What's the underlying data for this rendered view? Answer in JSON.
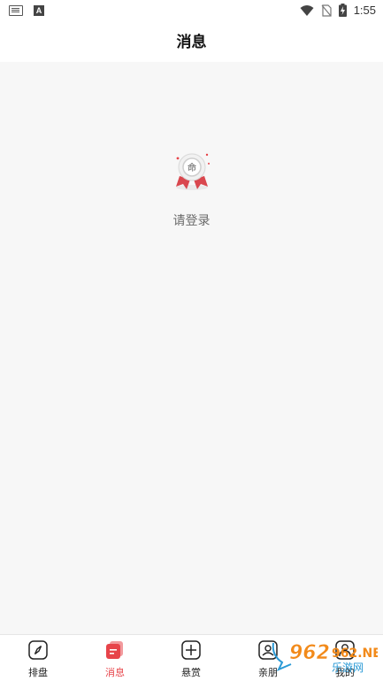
{
  "status_bar": {
    "time": "1:55",
    "icons": [
      "keyboard-icon",
      "a-icon",
      "wifi-icon",
      "no-sim-icon",
      "battery-charging-icon"
    ]
  },
  "header": {
    "title": "消息"
  },
  "empty_state": {
    "icon": "medal-icon",
    "text": "请登录"
  },
  "tabbar": {
    "tabs": [
      {
        "label": "排盘",
        "icon": "compass-icon",
        "active": false
      },
      {
        "label": "消息",
        "icon": "message-icon",
        "active": true
      },
      {
        "label": "悬赏",
        "icon": "plus-square-icon",
        "active": false
      },
      {
        "label": "亲朋",
        "icon": "contacts-icon",
        "active": false
      },
      {
        "label": "我的",
        "icon": "profile-icon",
        "active": false
      }
    ]
  },
  "watermark": {
    "text": "962.NET",
    "subtitle": "乐游网"
  },
  "colors": {
    "accent": "#e7444a",
    "background": "#f7f7f7",
    "bar": "#ffffff"
  }
}
